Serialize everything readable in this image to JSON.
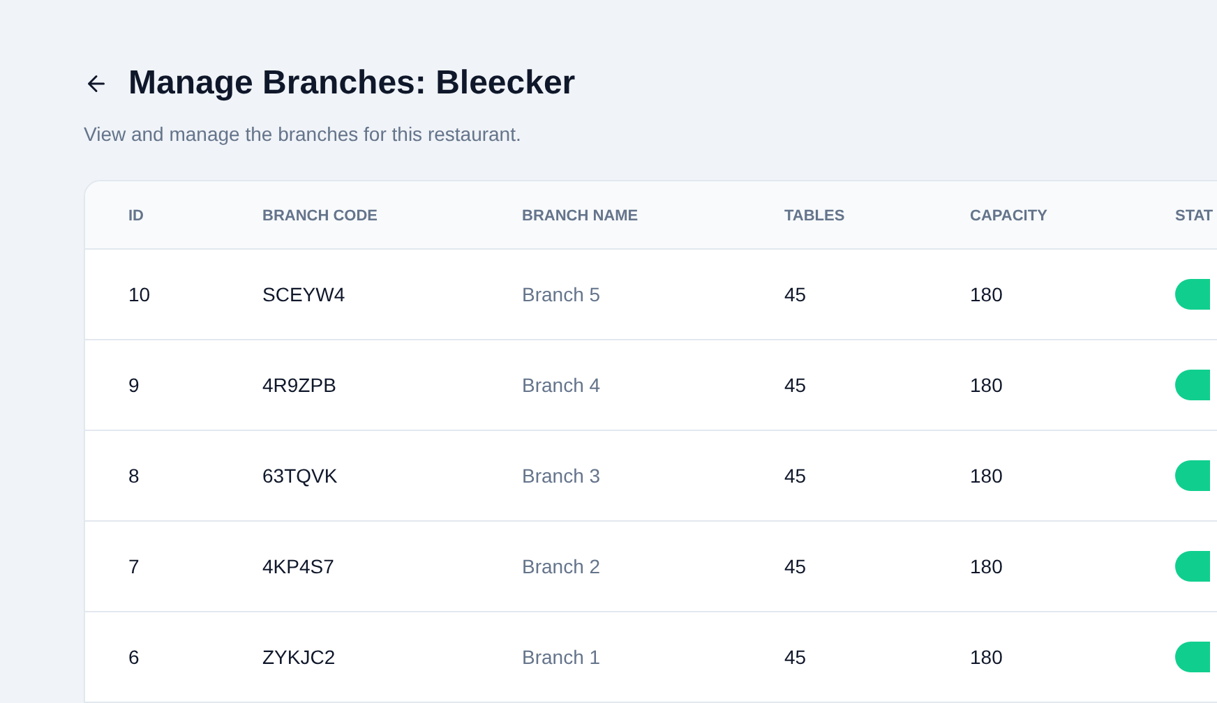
{
  "header": {
    "title": "Manage Branches: Bleecker",
    "subtitle": "View and manage the branches for this restaurant."
  },
  "table": {
    "columns": [
      "ID",
      "BRANCH CODE",
      "BRANCH NAME",
      "TABLES",
      "CAPACITY",
      "STAT"
    ],
    "rows": [
      {
        "id": "10",
        "code": "SCEYW4",
        "name": "Branch 5",
        "tables": "45",
        "capacity": "180",
        "status": {
          "color": "#10cf8e"
        }
      },
      {
        "id": "9",
        "code": "4R9ZPB",
        "name": "Branch 4",
        "tables": "45",
        "capacity": "180",
        "status": {
          "color": "#10cf8e"
        }
      },
      {
        "id": "8",
        "code": "63TQVK",
        "name": "Branch 3",
        "tables": "45",
        "capacity": "180",
        "status": {
          "color": "#10cf8e"
        }
      },
      {
        "id": "7",
        "code": "4KP4S7",
        "name": "Branch 2",
        "tables": "45",
        "capacity": "180",
        "status": {
          "color": "#10cf8e"
        }
      },
      {
        "id": "6",
        "code": "ZYKJC2",
        "name": "Branch 1",
        "tables": "45",
        "capacity": "180",
        "status": {
          "color": "#10cf8e"
        }
      }
    ]
  }
}
